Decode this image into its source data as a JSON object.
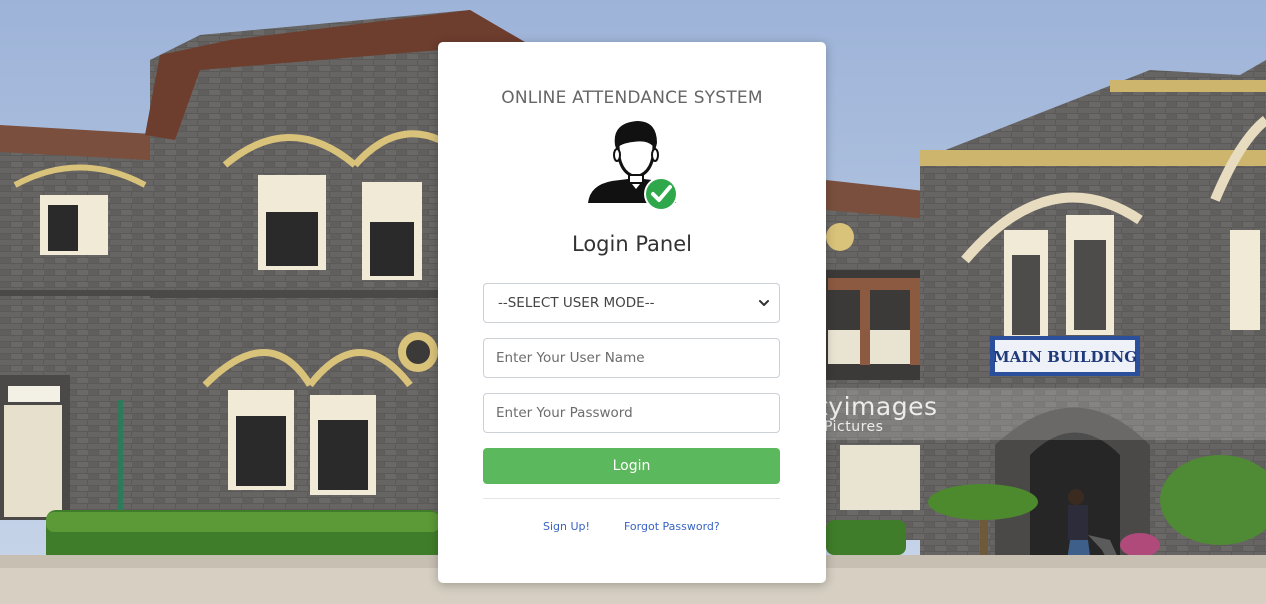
{
  "background": {
    "description_icon": "university-building-photo-icon",
    "watermark": {
      "brand": "tyimages",
      "sub": "Pictures"
    },
    "building_sign": "MAIN BUILDING"
  },
  "login": {
    "app_title": "ONLINE ATTENDANCE SYSTEM",
    "avatar_icon": "user-verified-icon",
    "panel_title": "Login Panel",
    "user_mode": {
      "selected": "--SELECT USER MODE--",
      "options": [
        "--SELECT USER MODE--"
      ]
    },
    "username": {
      "value": "",
      "placeholder": "Enter Your User Name"
    },
    "password": {
      "value": "",
      "placeholder": "Enter Your Password"
    },
    "login_label": "Login",
    "signup_label": "Sign Up!",
    "forgot_label": "Forgot Password?"
  },
  "colors": {
    "login_button": "#5cb85c",
    "link": "#3a63c4",
    "check_badge": "#2ea84a"
  }
}
